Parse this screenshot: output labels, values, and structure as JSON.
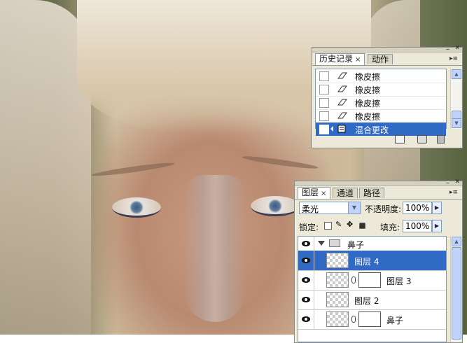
{
  "history_panel": {
    "tabs": [
      {
        "label": "历史记录",
        "close": "×"
      },
      {
        "label": "动作"
      }
    ],
    "menu_icon": "menu-arrow-icon",
    "items": [
      {
        "label": "橡皮擦",
        "icon": "eraser-icon"
      },
      {
        "label": "橡皮擦",
        "icon": "eraser-icon"
      },
      {
        "label": "橡皮擦",
        "icon": "eraser-icon"
      },
      {
        "label": "橡皮擦",
        "icon": "eraser-icon"
      },
      {
        "label": "混合更改",
        "icon": "blend-change-icon",
        "selected": true
      }
    ],
    "footer_buttons": [
      "new-document-from-state-icon",
      "snapshot-camera-icon",
      "trash-icon"
    ]
  },
  "layers_panel": {
    "tabs": [
      {
        "label": "图层",
        "close": "×"
      },
      {
        "label": "通道"
      },
      {
        "label": "路径"
      }
    ],
    "blend_mode": "柔光",
    "opacity_label": "不透明度:",
    "opacity_value": "100%",
    "lock_label": "锁定:",
    "fill_label": "填充:",
    "fill_value": "100%",
    "layers": [
      {
        "name": "鼻子",
        "type": "group",
        "visible": true
      },
      {
        "name": "图层 4",
        "type": "layer",
        "visible": true,
        "selected": true
      },
      {
        "name": "图层 3",
        "type": "layer-mask",
        "visible": true
      },
      {
        "name": "图层 2",
        "type": "layer",
        "visible": true
      },
      {
        "name": "鼻子",
        "type": "layer-mask",
        "visible": true
      }
    ]
  },
  "colors": {
    "selection": "#316ac5",
    "panel_bg": "#ece9d8"
  }
}
